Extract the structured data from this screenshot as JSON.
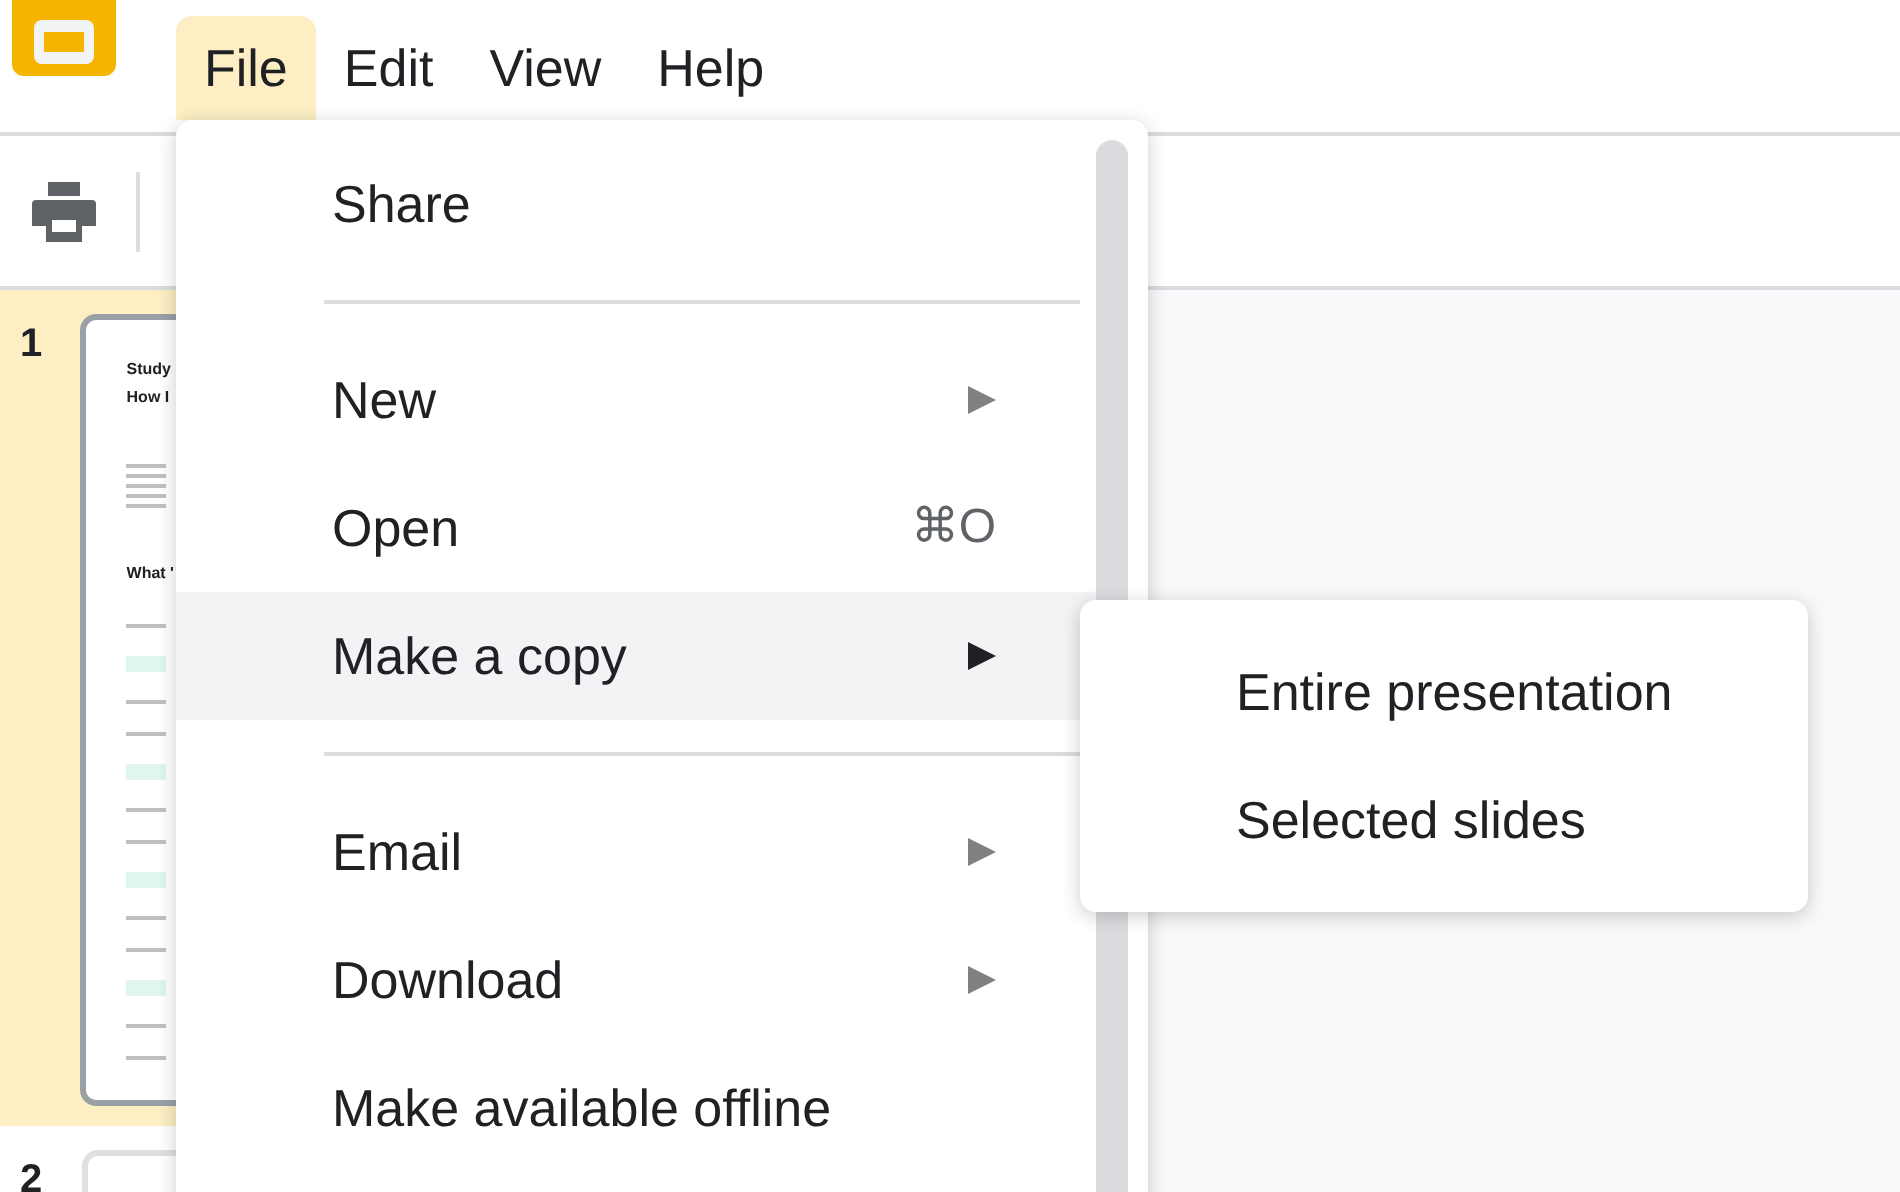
{
  "menubar": [
    {
      "label": "File",
      "selected": true
    },
    {
      "label": "Edit",
      "selected": false
    },
    {
      "label": "View",
      "selected": false
    },
    {
      "label": "Help",
      "selected": false
    }
  ],
  "slides": [
    {
      "number": "1",
      "selected": true,
      "headings": [
        "Study",
        "How I",
        "What '"
      ]
    },
    {
      "number": "2",
      "selected": false
    }
  ],
  "file_menu": {
    "items": [
      {
        "kind": "item",
        "label": "Share",
        "submenu": false,
        "selected": false
      },
      {
        "kind": "divider"
      },
      {
        "kind": "item",
        "label": "New",
        "submenu": true,
        "selected": false
      },
      {
        "kind": "item",
        "label": "Open",
        "shortcut": "⌘O",
        "submenu": false,
        "selected": false
      },
      {
        "kind": "item",
        "label": "Make a copy",
        "submenu": true,
        "selected": true
      },
      {
        "kind": "divider"
      },
      {
        "kind": "item",
        "label": "Email",
        "submenu": true,
        "selected": false
      },
      {
        "kind": "item",
        "label": "Download",
        "submenu": true,
        "selected": false
      },
      {
        "kind": "item",
        "label": "Make available offline",
        "submenu": false,
        "selected": false
      }
    ]
  },
  "submenu": {
    "items": [
      "Entire presentation",
      "Selected slides"
    ]
  }
}
